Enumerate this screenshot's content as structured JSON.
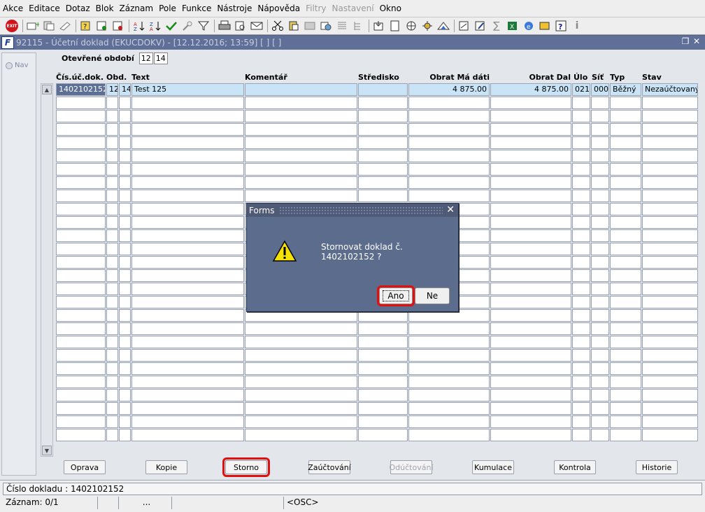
{
  "menu": [
    "Akce",
    "Editace",
    "Dotaz",
    "Blok",
    "Záznam",
    "Pole",
    "Funkce",
    "Nástroje",
    "Nápověda",
    "Filtry",
    "Nastavení",
    "Okno"
  ],
  "menu_disabled": [
    "Filtry",
    "Nastavení"
  ],
  "toolbar": {
    "exit_label": "EXIT",
    "icons": [
      "exit-icon",
      "sep",
      "add-row-icon",
      "copy-record-icon",
      "clear-icon",
      "sep",
      "query-enter-icon",
      "query-execute-icon",
      "query-cancel-icon",
      "sep",
      "sort-asc-icon",
      "sort-desc-icon",
      "check-icon",
      "key-icon",
      "filter-icon",
      "sep",
      "print-icon",
      "print-preview-icon",
      "mail-icon",
      "sep",
      "cut-icon",
      "paste-icon",
      "tool1-icon",
      "tool2-icon",
      "list-icon",
      "tree-icon",
      "sep",
      "export-icon",
      "doc-icon",
      "globe-icon",
      "settings-icon",
      "mountain-icon",
      "sep",
      "calc-icon",
      "edit-icon",
      "sum-icon",
      "excel-icon",
      "ie-icon",
      "sound-icon",
      "help-icon",
      "info-icon"
    ]
  },
  "window": {
    "title": "92115 - Účetní doklad (EKUCDOKV) - [12.12.2016; 13:59]  [ ]  [ ]",
    "restore_glyph": "❐",
    "close_glyph": "✕"
  },
  "nav": {
    "label": "Nav"
  },
  "obdobi": {
    "label": "Otevřené období",
    "v1": "12",
    "v2": "14"
  },
  "columns": [
    "Čís.úč.dok.",
    "Obd.",
    "Text",
    "Komentář",
    "Středisko",
    "Obrat Má dáti",
    "Obrat Dal",
    "Úlo",
    "Síť",
    "Typ",
    "Stav"
  ],
  "rows": [
    [
      "1402102152",
      "12",
      "14",
      "Test 125",
      "",
      "",
      "4 875.00",
      "4 875.00",
      "021",
      "000",
      "Běžný",
      "Nezaúčtovaný"
    ]
  ],
  "empty_rows": 26,
  "buttons": [
    "Oprava",
    "Kopie",
    "Storno",
    "Zaúčtování",
    "Odúčtování",
    "Kumulace",
    "Kontrola",
    "Historie"
  ],
  "buttons_disabled": [
    "Odúčtování"
  ],
  "status": {
    "line1": "Číslo dokladu : 1402102152",
    "record": "Záznam: 0/1",
    "seg3": "...",
    "seg5": "<OSC>"
  },
  "dialog": {
    "title": "Forms",
    "message": "Stornovat doklad č. 1402102152 ?",
    "yes": "Ano",
    "no": "Ne"
  },
  "colors": {
    "highlight_frame": "#e01010",
    "title_bg": "#5f6f98",
    "selected_row": "#c9e4f7"
  }
}
